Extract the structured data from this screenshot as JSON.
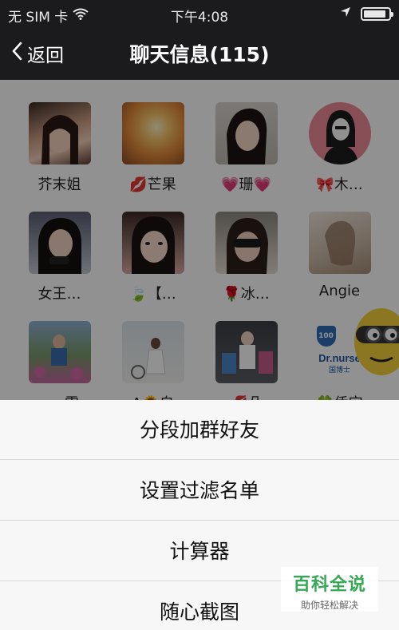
{
  "status_bar": {
    "carrier": "无 SIM 卡",
    "time": "下午4:08",
    "battery_level": 0.9
  },
  "nav": {
    "back_label": "返回",
    "title": "聊天信息(115)"
  },
  "members": [
    {
      "name": "芥末姐"
    },
    {
      "name": "💋芒果"
    },
    {
      "name": "💗珊💗"
    },
    {
      "name": "🎀木…"
    },
    {
      "name": "女王…"
    },
    {
      "name": "🍃【…"
    },
    {
      "name": "🌹冰…"
    },
    {
      "name": "Angie"
    },
    {
      "name": "zax雪"
    },
    {
      "name": "A🌻自"
    },
    {
      "name": "💋朵"
    },
    {
      "name": "🍀侨宝"
    }
  ],
  "avatar_texts": {
    "dr_nurse": "Dr.nurse",
    "dr_nurse_cn": "国博士",
    "badge": "100"
  },
  "action_sheet": [
    {
      "label": "分段加群好友"
    },
    {
      "label": "设置过滤名单"
    },
    {
      "label": "计算器"
    },
    {
      "label": "随心截图"
    }
  ],
  "watermark": {
    "title": "百科全说",
    "subtitle": "助你轻松解决"
  },
  "colors": {
    "bar": "#1b1b1d",
    "sheet": "#f7f7f7",
    "watermark_green": "#34a853"
  }
}
